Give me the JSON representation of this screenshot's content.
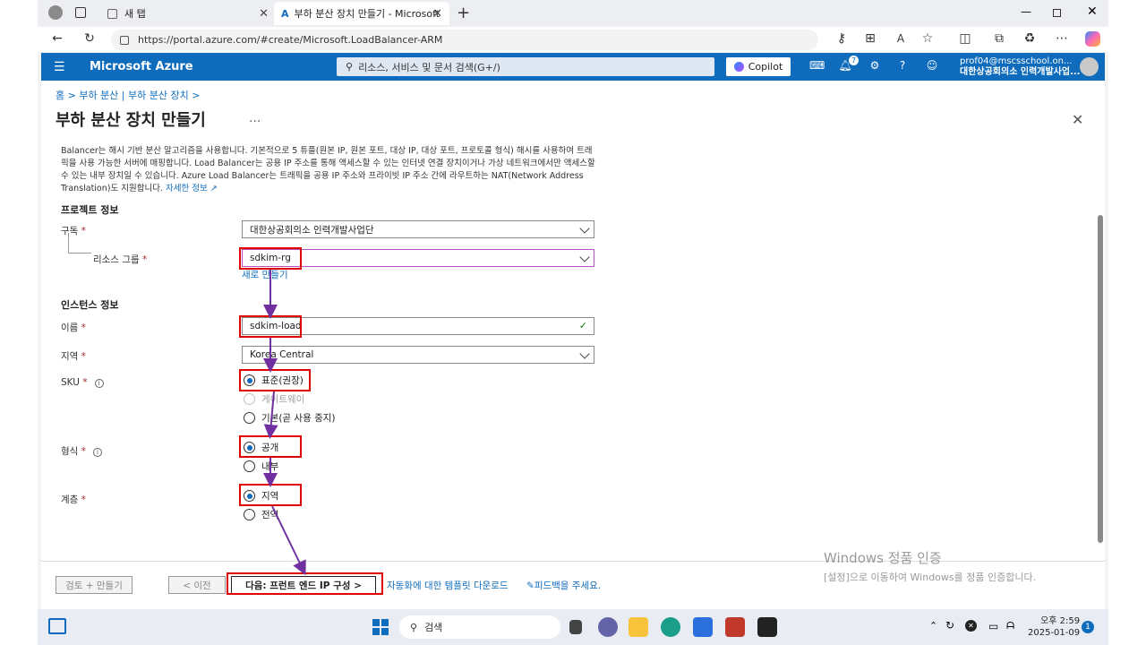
{
  "browser": {
    "tab1_label": "새 탭",
    "tab2_label": "부하 분산 장치 만들기 - Microsoft",
    "url": "https://portal.azure.com/#create/Microsoft.LoadBalancer-ARM"
  },
  "azure": {
    "brand": "Microsoft Azure",
    "search_placeholder": "리소스, 서비스 및 문서 검색(G+/)",
    "copilot": "Copilot",
    "notif_count": "7",
    "user_email": "prof04@mscsschool.on...",
    "user_org": "대한상공회의소 인력개발사업..."
  },
  "page": {
    "breadcrumb": "홈 > 부하 분산 | 부하 분산 장치 >",
    "title": "부하 분산 장치 만들기",
    "more": "...",
    "description": "Balancer는 해시 기반 분산 알고리즘을 사용합니다. 기본적으로 5 튜플(원본 IP, 원본 포트, 대상 IP, 대상 포트, 프로토콜 형식) 해시를 사용하여 트래픽을 사용 가능한 서버에 매핑합니다. Load Balancer는 공용 IP 주소를 통해 액세스할 수 있는 인터넷 연결 장치이거나 가상 네트워크에서만 액세스할 수 있는 내부 장치일 수 있습니다. Azure Load Balancer는 트래픽을 공용 IP 주소와 프라이빗 IP 주소 간에 라우트하는 NAT(Network Address Translation)도 지원합니다.",
    "learn_more": "자세한 정보"
  },
  "form": {
    "project_section": "프로젝트 정보",
    "subscription_label": "구독",
    "subscription_value": "대한상공회의소 인력개발사업단",
    "rg_label": "리소스 그룹",
    "rg_value": "sdkim-rg",
    "new_link": "새로 만들기",
    "instance_section": "인스턴스 정보",
    "name_label": "이름",
    "name_value": "sdkim-load",
    "region_label": "지역",
    "region_value": "Korea Central",
    "sku_label": "SKU",
    "sku_options": [
      "표준(권장)",
      "게이트웨이",
      "기본(곧 사용 중지)"
    ],
    "type_label": "형식",
    "type_options": [
      "공개",
      "내부"
    ],
    "tier_label": "계층",
    "tier_options": [
      "지역",
      "전역"
    ]
  },
  "footer": {
    "review_button": "검토 + 만들기",
    "prev_button": "< 이전",
    "next_button": "다음: 프런트 엔드 IP 구성 >",
    "template_link": "자동화에 대한 템플릿 다운로드",
    "feedback_link": "피드백을 주세요."
  },
  "watermark": {
    "line1": "Windows 정품 인증",
    "line2": "[설정]으로 이동하여 Windows를 정품 인증합니다."
  },
  "taskbar": {
    "search": "검색",
    "time": "오후 2:59",
    "date": "2025-01-09",
    "notifications": "1"
  },
  "colors": {
    "azure_blue": "#0f6cbd",
    "highlight_red": "#e00000",
    "arrow_purple": "#7030a0"
  }
}
